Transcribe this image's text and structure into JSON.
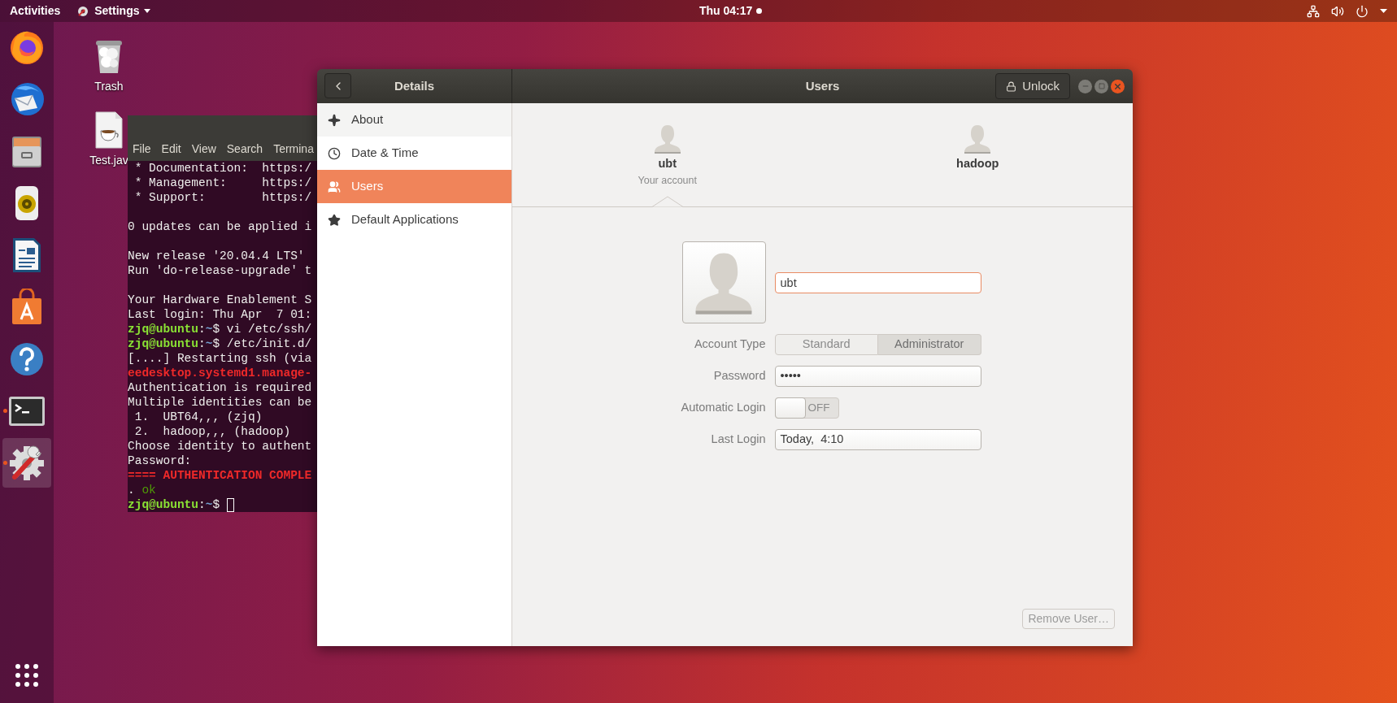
{
  "top_bar": {
    "activities": "Activities",
    "app_menu": "Settings",
    "clock": "Thu 04:17",
    "notification": true
  },
  "dock": [
    {
      "kind": "browser",
      "running": false,
      "focused": false
    },
    {
      "kind": "mail",
      "running": false,
      "focused": false
    },
    {
      "kind": "files",
      "running": false,
      "focused": false
    },
    {
      "kind": "music",
      "running": false,
      "focused": false
    },
    {
      "kind": "writer",
      "running": false,
      "focused": false
    },
    {
      "kind": "store",
      "running": false,
      "focused": false
    },
    {
      "kind": "help",
      "running": false,
      "focused": false
    },
    {
      "kind": "terminal",
      "running": true,
      "focused": false
    },
    {
      "kind": "settings",
      "running": true,
      "focused": true
    }
  ],
  "desktop_icons": [
    {
      "kind": "trash",
      "label": "Trash"
    },
    {
      "kind": "java-file",
      "label": "Test.jav"
    }
  ],
  "terminal": {
    "menu": [
      "File",
      "Edit",
      "View",
      "Search",
      "Termina"
    ],
    "cursor": true,
    "paragraphs": [
      [
        [
          {
            "text": " * Documentation:  https:/",
            "kind": "plain"
          }
        ],
        [
          {
            "text": " * Management:     https:/",
            "kind": "plain"
          }
        ],
        [
          {
            "text": " * Support:        https:/",
            "kind": "plain"
          }
        ]
      ],
      [
        [
          {
            "text": "0 updates can be applied i",
            "kind": "plain"
          }
        ]
      ],
      [
        [
          {
            "text": "New release '20.04.4 LTS'",
            "kind": "plain"
          }
        ],
        [
          {
            "text": "Run 'do-release-upgrade' t",
            "kind": "plain"
          }
        ]
      ],
      [
        [
          {
            "text": "Your Hardware Enablement S",
            "kind": "plain"
          }
        ],
        [
          {
            "text": "Last login: Thu Apr  7 01:",
            "kind": "plain"
          }
        ],
        [
          {
            "text": "zjq@ubuntu",
            "kind": "user"
          },
          {
            "text": ":",
            "kind": "plain"
          },
          {
            "text": "~",
            "kind": "path"
          },
          {
            "text": "$ vi /etc/ssh/",
            "kind": "plain"
          }
        ],
        [
          {
            "text": "zjq@ubuntu",
            "kind": "user"
          },
          {
            "text": ":",
            "kind": "plain"
          },
          {
            "text": "~",
            "kind": "path"
          },
          {
            "text": "$ /etc/init.d/",
            "kind": "plain"
          }
        ],
        [
          {
            "text": "[....] Restarting ssh (via",
            "kind": "plain"
          }
        ],
        [
          {
            "text": "eedesktop.systemd1.manage-",
            "kind": "alert"
          }
        ],
        [
          {
            "text": "Authentication is required",
            "kind": "plain"
          }
        ],
        [
          {
            "text": "Multiple identities can be",
            "kind": "plain"
          }
        ],
        [
          {
            "text": " 1.  UBT64,,, (zjq)",
            "kind": "plain"
          }
        ],
        [
          {
            "text": " 2.  hadoop,,, (hadoop)",
            "kind": "plain"
          }
        ],
        [
          {
            "text": "Choose identity to authent",
            "kind": "plain"
          }
        ],
        [
          {
            "text": "Password:",
            "kind": "plain"
          }
        ],
        [
          {
            "text": "==== AUTHENTICATION COMPLE",
            "kind": "alert"
          }
        ],
        [
          {
            "text": ". ",
            "kind": "plain"
          },
          {
            "text": "ok",
            "kind": "ok"
          }
        ],
        [
          {
            "text": "zjq@ubuntu",
            "kind": "user"
          },
          {
            "text": ":",
            "kind": "plain"
          },
          {
            "text": "~",
            "kind": "path"
          },
          {
            "text": "$ ",
            "kind": "plain"
          }
        ]
      ]
    ]
  },
  "settings": {
    "panel_title": "Details",
    "title": "Users",
    "unlock": "Unlock",
    "sidebar": [
      {
        "kind": "about",
        "label": "About",
        "selected": false,
        "hovered": true
      },
      {
        "kind": "time",
        "label": "Date & Time",
        "selected": false,
        "hovered": false
      },
      {
        "kind": "users",
        "label": "Users",
        "selected": true,
        "hovered": false
      },
      {
        "kind": "apps",
        "label": "Default Applications",
        "selected": false,
        "hovered": false
      }
    ],
    "users": [
      {
        "name": "ubt",
        "subtitle": "Your account",
        "selected": true
      },
      {
        "name": "hadoop",
        "selected": false
      }
    ],
    "name_field": {
      "value": "ubt",
      "focused": true
    },
    "rows": [
      {
        "kind": "segmented",
        "label": "Account Type",
        "options": [
          {
            "label": "Standard",
            "selected": false
          },
          {
            "label": "Administrator",
            "selected": true
          }
        ]
      },
      {
        "kind": "field",
        "label": "Password",
        "value": "•••••"
      },
      {
        "kind": "switch",
        "label": "Automatic Login",
        "on": false,
        "state_label": "OFF"
      },
      {
        "kind": "field",
        "label": "Last Login",
        "value": "Today,  4:10"
      }
    ],
    "remove_button": {
      "label": "Remove User…",
      "disabled": true
    }
  }
}
